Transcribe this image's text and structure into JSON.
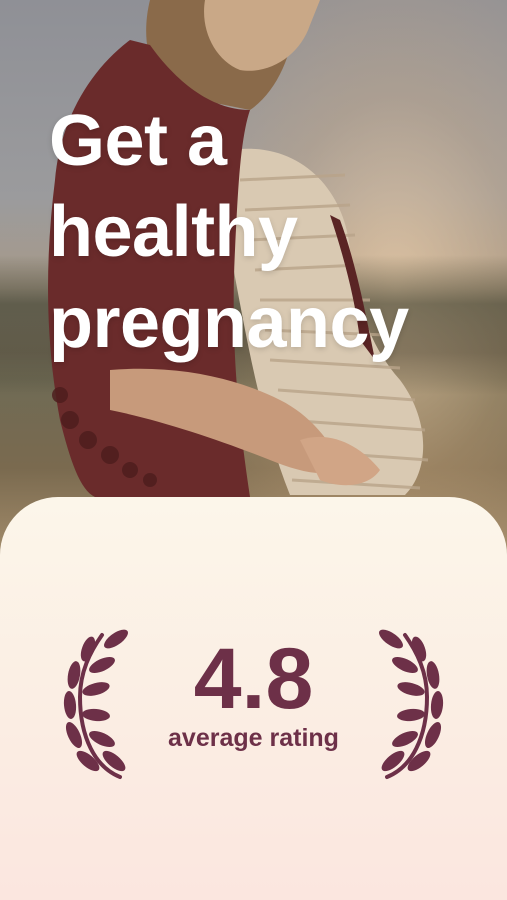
{
  "hero": {
    "headline_lines": [
      "Get a",
      "healthy",
      "pregnancy"
    ],
    "image": "pregnant-woman-field-photo"
  },
  "rating": {
    "value": "4.8",
    "caption": "average rating"
  },
  "colors": {
    "accent": "#6d3048",
    "card_top": "#fcf6ea",
    "card_bottom": "#fbe6df",
    "headline": "#ffffff"
  },
  "icons": [
    "laurel-left-icon",
    "laurel-right-icon"
  ]
}
